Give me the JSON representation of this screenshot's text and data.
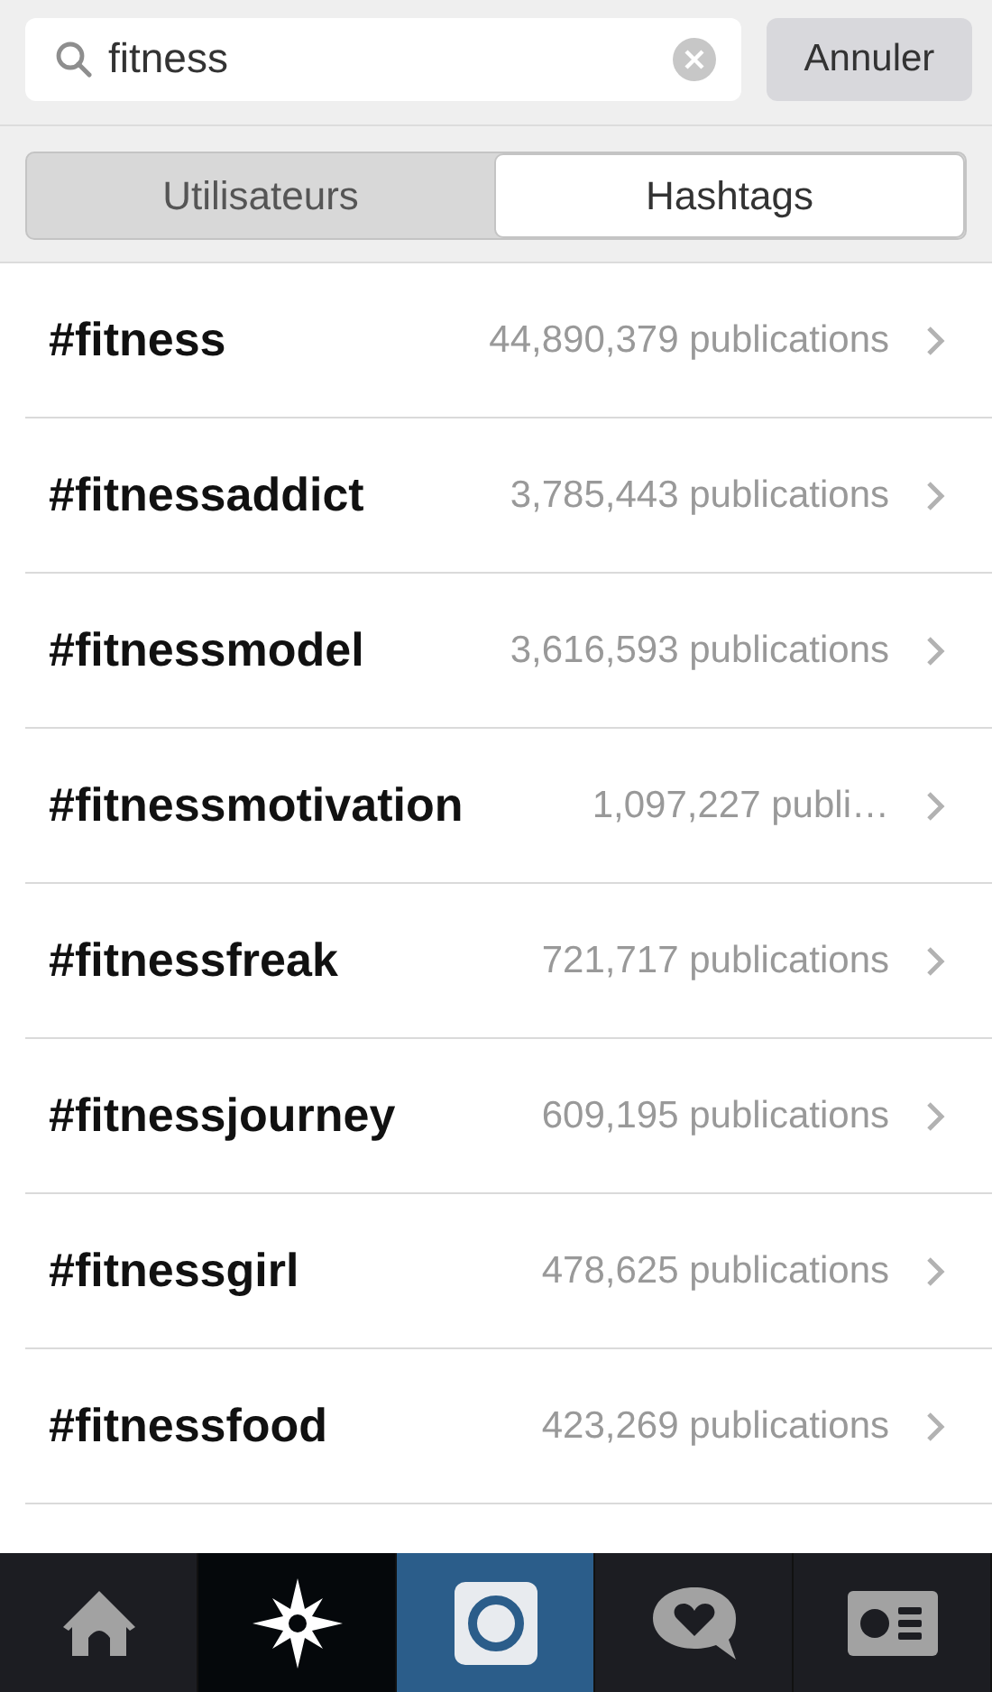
{
  "search": {
    "value": "fitness",
    "cancel": "Annuler"
  },
  "segments": [
    {
      "label": "Utilisateurs",
      "selected": false
    },
    {
      "label": "Hashtags",
      "selected": true
    }
  ],
  "results": [
    {
      "tag": "#fitness",
      "count": "44,890,379 publications"
    },
    {
      "tag": "#fitnessaddict",
      "count": "3,785,443 publications"
    },
    {
      "tag": "#fitnessmodel",
      "count": "3,616,593 publications"
    },
    {
      "tag": "#fitnessmotivation",
      "count": "1,097,227 publi…"
    },
    {
      "tag": "#fitnessfreak",
      "count": "721,717 publications"
    },
    {
      "tag": "#fitnessjourney",
      "count": "609,195 publications"
    },
    {
      "tag": "#fitnessgirl",
      "count": "478,625 publications"
    },
    {
      "tag": "#fitnessfood",
      "count": "423,269 publications"
    }
  ],
  "tab_bar": [
    {
      "kind": "home",
      "selected": false
    },
    {
      "kind": "explore",
      "selected": true
    },
    {
      "kind": "camera",
      "selected": false
    },
    {
      "kind": "activity",
      "selected": false
    },
    {
      "kind": "profile",
      "selected": false
    }
  ]
}
